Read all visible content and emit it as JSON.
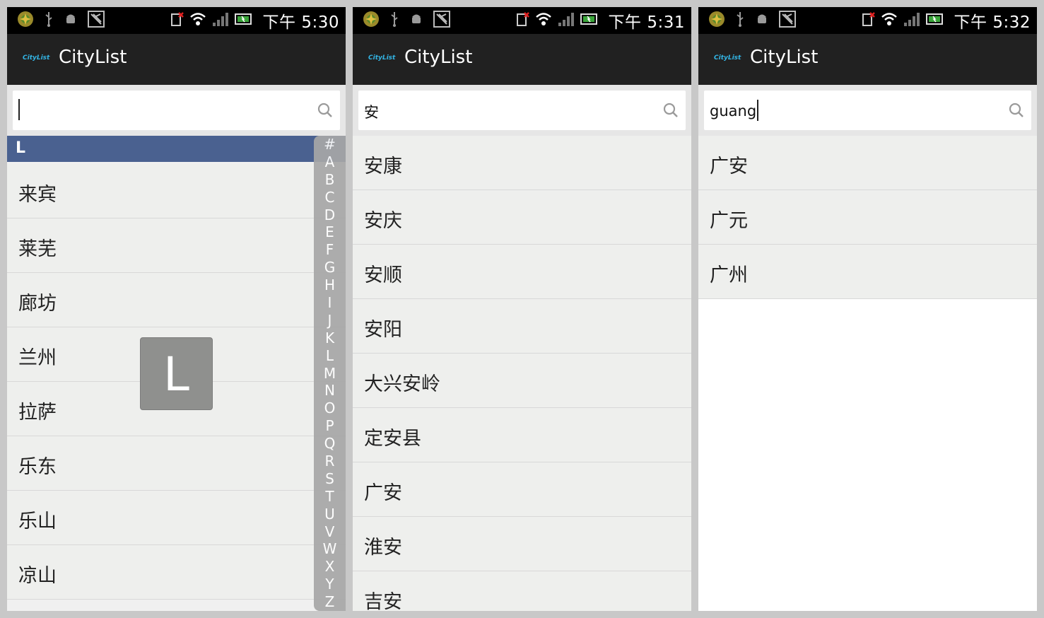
{
  "screens": [
    {
      "status": {
        "time": "下午 5:30"
      },
      "app": {
        "logo": "CityList",
        "title": "CityList"
      },
      "search": {
        "value": ""
      },
      "section_header": "L",
      "overlay_letter": "L",
      "cities": [
        "来宾",
        "莱芜",
        "廊坊",
        "兰州",
        "拉萨",
        "乐东",
        "乐山",
        "凉山"
      ],
      "alphabet": [
        "#",
        "A",
        "B",
        "C",
        "D",
        "E",
        "F",
        "G",
        "H",
        "I",
        "J",
        "K",
        "L",
        "M",
        "N",
        "O",
        "P",
        "Q",
        "R",
        "S",
        "T",
        "U",
        "V",
        "W",
        "X",
        "Y",
        "Z"
      ]
    },
    {
      "status": {
        "time": "下午 5:31"
      },
      "app": {
        "logo": "CityList",
        "title": "CityList"
      },
      "search": {
        "value": "安"
      },
      "cities": [
        "安康",
        "安庆",
        "安顺",
        "安阳",
        "大兴安岭",
        "定安县",
        "广安",
        "淮安",
        "吉安"
      ]
    },
    {
      "status": {
        "time": "下午 5:32"
      },
      "app": {
        "logo": "CityList",
        "title": "CityList"
      },
      "search": {
        "value": "guang"
      },
      "cities": [
        "广安",
        "广元",
        "广州"
      ]
    }
  ],
  "icons": [
    "app-notification-icon",
    "usb-icon",
    "android-debug-icon",
    "image-notification-icon",
    "sim-missing-icon",
    "wifi-icon",
    "signal-icon",
    "battery-icon",
    "search-icon"
  ],
  "colors": {
    "section_header": "#4a6190",
    "action_bar": "#212121",
    "logo_accent": "#33b5e5",
    "index_bar": "#a7a7a7",
    "overlay": "#8f908e"
  }
}
